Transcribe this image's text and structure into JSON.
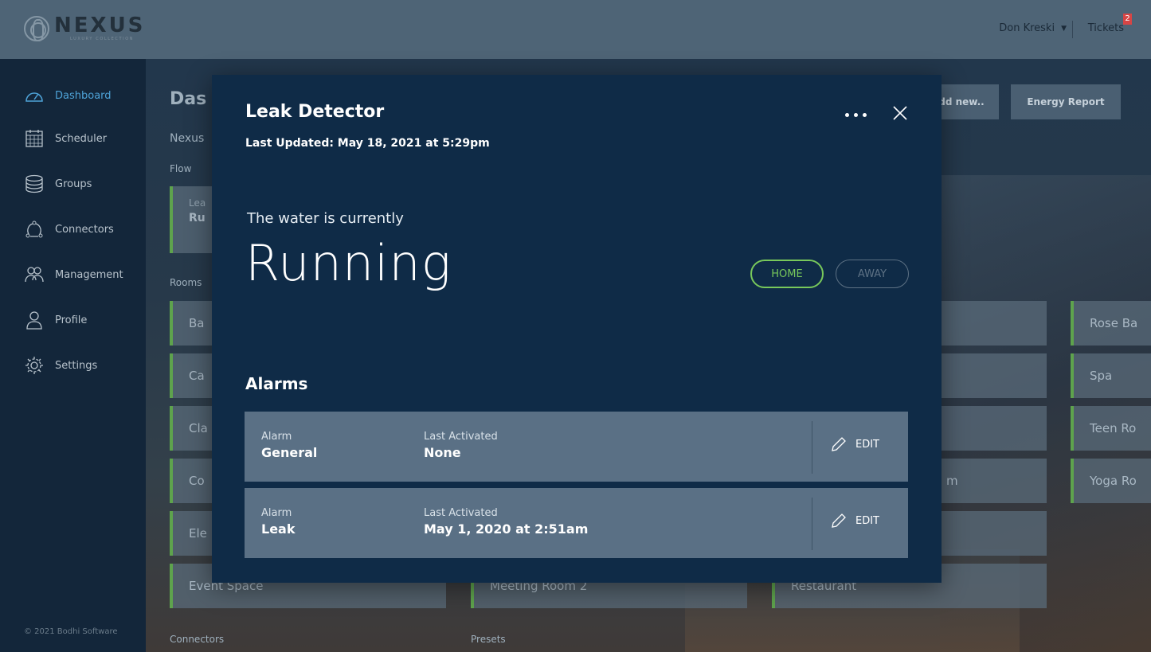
{
  "app": {
    "logo_word": "NEXUS",
    "logo_sub": "LUXURY COLLECTION",
    "user_name": "Don Kreski",
    "tickets_label": "Tickets",
    "tickets_count": "2"
  },
  "sidebar": {
    "items": [
      {
        "label": "Dashboard",
        "icon": "dashboard-icon"
      },
      {
        "label": "Scheduler",
        "icon": "calendar-icon"
      },
      {
        "label": "Groups",
        "icon": "database-icon"
      },
      {
        "label": "Connectors",
        "icon": "connectors-icon"
      },
      {
        "label": "Management",
        "icon": "users-icon"
      },
      {
        "label": "Profile",
        "icon": "user-icon"
      },
      {
        "label": "Settings",
        "icon": "gear-icon"
      }
    ],
    "copyright": "© 2021 Bodhi Software"
  },
  "background": {
    "title": "Das",
    "subtitle": "Nexus",
    "flow_label": "Flow",
    "flow_card_line1": "Lea",
    "flow_card_line2": "Ru",
    "rooms_label": "Rooms",
    "add_new_button": "dd new..",
    "energy_report_button": "Energy Report",
    "rooms": [
      "Ba",
      "Ca",
      "Cla",
      "Co",
      "Ele",
      "Event Space",
      "Meeting Room 2",
      "Restaurant",
      "m",
      "Rose Ba",
      "Spa",
      "Teen Ro",
      "Yoga Ro"
    ],
    "connectors_label": "Connectors",
    "presets_label": "Presets"
  },
  "modal": {
    "title": "Leak Detector",
    "last_updated": "Last Updated: May 18, 2021 at 5:29pm",
    "status_label": "The water is currently",
    "status_value": "Running",
    "mode_home": "HOME",
    "mode_away": "AWAY",
    "accent_color": "#78c85b",
    "alarms_heading": "Alarms",
    "alarms": [
      {
        "alarm_label": "Alarm",
        "alarm_value": "General",
        "activated_label": "Last Activated",
        "activated_value": "None",
        "edit_label": "EDIT"
      },
      {
        "alarm_label": "Alarm",
        "alarm_value": "Leak",
        "activated_label": "Last Activated",
        "activated_value": "May 1, 2020 at 2:51am",
        "edit_label": "EDIT"
      }
    ]
  }
}
